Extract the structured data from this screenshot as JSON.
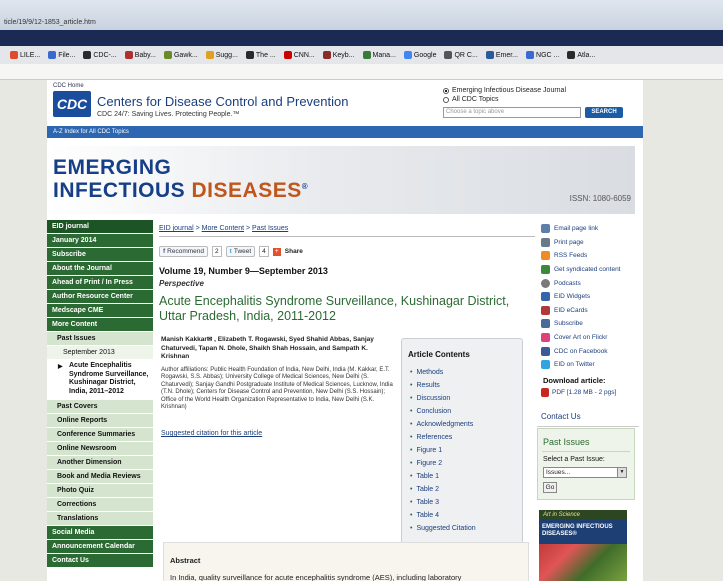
{
  "browser": {
    "address": "ticle/19/9/12-1853_article.htm",
    "bookmarks": [
      "LILE...",
      "File...",
      "CDC-...",
      "Baby...",
      "Gawk...",
      "Sugg...",
      "The ...",
      "CNN...",
      "Keyb...",
      "Mana...",
      "Google",
      "QR C...",
      "Emer...",
      "NGC ...",
      "Atla..."
    ]
  },
  "cdc": {
    "home": "CDC Home",
    "logo": "CDC",
    "name": "Centers for Disease Control and Prevention",
    "tagline": "CDC 24/7: Saving Lives. Protecting People.™",
    "radio_eid": "Emerging Infectious Disease Journal",
    "radio_all": "All CDC Topics",
    "search_placeholder": "Choose a topic above",
    "search_button": "SEARCH",
    "az_index": "A-Z Index for All CDC Topics"
  },
  "banner": {
    "line1": "EMERGING",
    "line2a": "INFECTIOUS ",
    "line2b": "DISEASES",
    "reg": "®",
    "issn": "ISSN: 1080-6059"
  },
  "leftnav": {
    "items": [
      "EID journal",
      "January 2014",
      "Subscribe",
      "About the Journal",
      "Ahead of Print / In Press",
      "Author Resource Center",
      "Medscape CME",
      "More Content"
    ],
    "past_issues": "Past Issues",
    "sept": "September 2013",
    "current_article": "Acute Encephalitis Syndrome Surveillance, Kushinagar District, India, 2011–2012",
    "sub_items": [
      "Past Covers",
      "Online Reports",
      "Conference Summaries",
      "Online Newsroom",
      "Another Dimension",
      "Book and Media Reviews",
      "Photo Quiz",
      "Corrections",
      "Translations"
    ],
    "bottom_items": [
      "Social Media",
      "Announcement Calendar",
      "Contact Us"
    ]
  },
  "content": {
    "breadcrumb": [
      "EID journal",
      "More Content",
      "Past Issues"
    ],
    "recommend": "Recommend",
    "recommend_count": "2",
    "tweet": "Tweet",
    "tweet_count": "4",
    "share": "Share",
    "volume": "Volume 19, Number 9—September 2013",
    "section": "Perspective",
    "title": "Acute Encephalitis Syndrome Surveillance, Kushinagar District, Uttar Pradesh, India, 2011-2012",
    "authors": "Manish Kakkar✉ , Elizabeth T. Rogawski, Syed Shahid Abbas, Sanjay Chaturvedi, Tapan N. Dhole, Shaikh Shah Hossain, and Sampath K. Krishnan",
    "affiliations": "Author affiliations: Public Health Foundation of India, New Delhi, India (M. Kakkar, E.T. Rogawski, S.S. Abbas); University College of Medical Sciences, New Delhi (S. Chaturvedi); Sanjay Gandhi Postgraduate Institute of Medical Sciences, Lucknow, India (T.N. Dhole); Centers for Disease Control and Prevention, New Delhi (S.S. Hossain); Office of the World Health Organization Representative to India, New Delhi (S.K. Krishnan)",
    "citation_link": "Suggested citation for this article",
    "toc_title": "Article Contents",
    "toc": [
      "Methods",
      "Results",
      "Discussion",
      "Conclusion",
      "Acknowledgments",
      "References",
      "Figure 1",
      "Figure 2",
      "Table 1",
      "Table 2",
      "Table 3",
      "Table 4",
      "Suggested Citation"
    ],
    "abstract_title": "Abstract",
    "abstract_text": "In India, quality surveillance for acute encephalitis syndrome (AES), including laboratory"
  },
  "right": {
    "links": [
      {
        "label": "Email page link",
        "icon": "email-icon",
        "color": "#5b7fa8"
      },
      {
        "label": "Print page",
        "icon": "print-icon",
        "color": "#6a7a8a"
      },
      {
        "label": "RSS Feeds",
        "icon": "rss-icon",
        "color": "#f08a24"
      },
      {
        "label": "Get syndicated content",
        "icon": "syndicate-icon",
        "color": "#3a8a3a"
      },
      {
        "label": "Podcasts",
        "icon": "podcast-icon",
        "color": "#7a7a7a"
      },
      {
        "label": "EID Widgets",
        "icon": "widget-icon",
        "color": "#3366aa"
      },
      {
        "label": "EID eCards",
        "icon": "ecard-icon",
        "color": "#b03a3a"
      },
      {
        "label": "Subscribe",
        "icon": "subscribe-icon",
        "color": "#4a6a9a"
      },
      {
        "label": "Cover Art on Flickr",
        "icon": "flickr-icon",
        "color": "#e0407a"
      },
      {
        "label": "CDC on Facebook",
        "icon": "facebook-icon",
        "color": "#3b5998"
      },
      {
        "label": "EID on Twitter",
        "icon": "twitter-icon",
        "color": "#2fa4e0"
      }
    ],
    "download_title": "Download article:",
    "pdf": "PDF [1.28 MB - 2 pgs]",
    "contact": "Contact Us",
    "past_title": "Past Issues",
    "past_label": "Select a Past Issue:",
    "past_select": "Issues...",
    "go": "Go",
    "ais_top": "Art in Science",
    "ais_title": "EMERGING INFECTIOUS DISEASES®"
  }
}
